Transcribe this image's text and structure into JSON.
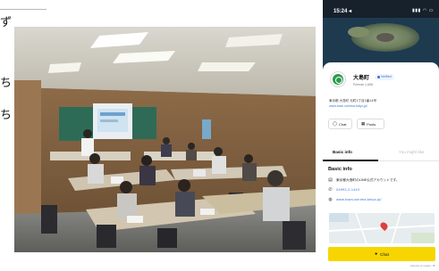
{
  "left_fragments": [
    {
      "text": "ず"
    },
    {
      "text": "ち"
    },
    {
      "text": "ち"
    }
  ],
  "photo": {
    "description_tag": "classroom-photo"
  },
  "phone": {
    "status": {
      "time": "15:24 ◂",
      "icons": "▮▮▮ ◠ ▭"
    },
    "profile": {
      "name": "大島町",
      "verified_label": "Verified",
      "friends": "Friends 1,658",
      "address": "東京都 大島町 元町1丁目1番14号",
      "url": "www.town.oshima.tokyo.jp/"
    },
    "actions": {
      "chat_label": "Chat",
      "posts_label": "Posts"
    },
    "tabs": [
      {
        "label": "Basic info"
      },
      {
        "label": "You might like"
      }
    ],
    "basic_info": {
      "title": "Basic info",
      "description": "東京都大島町のLINE公式アカウントです。",
      "phone": "04992-2-1443",
      "website": "www.town.oshima.tokyo.jp/"
    },
    "chat_button_label": "Chat",
    "footnote": "Country or region: JP",
    "colors": {
      "accent_yellow": "#f6d500",
      "link_blue": "#3a7bd5",
      "brand_green": "#2c9b4b"
    }
  }
}
